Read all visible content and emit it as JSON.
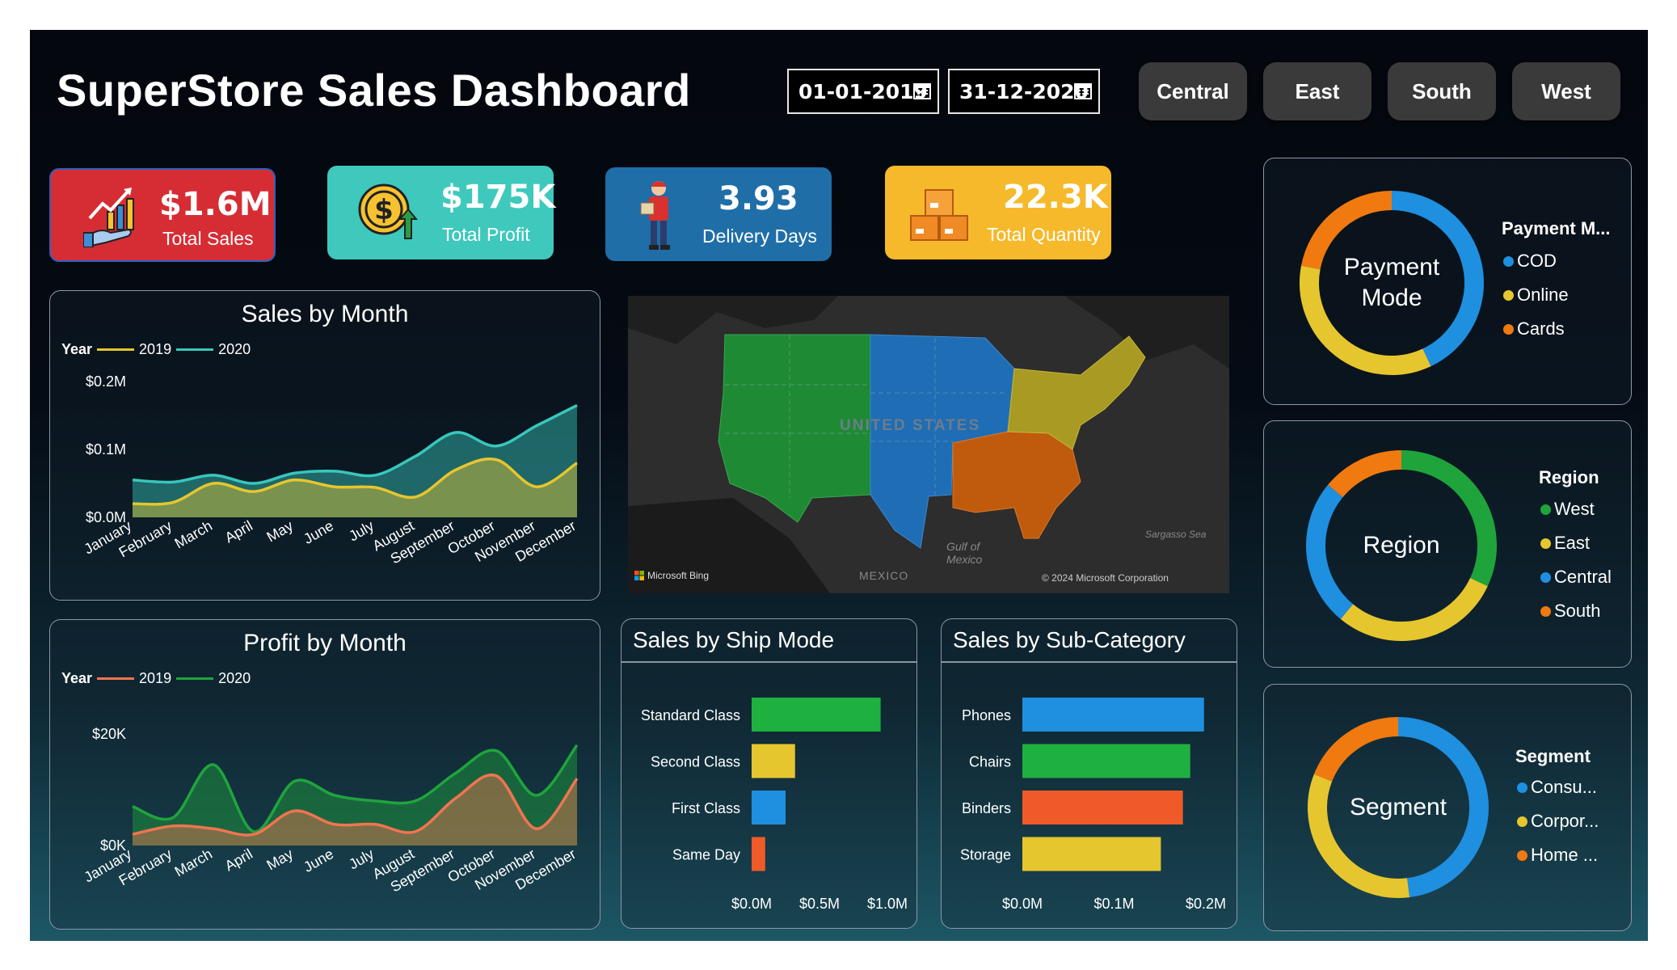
{
  "dashboard": {
    "title": "SuperStore Sales Dashboard",
    "date_start": "01-01-2019",
    "date_end": "31-12-2020",
    "region_buttons": [
      "Central",
      "East",
      "South",
      "West"
    ]
  },
  "kpis": [
    {
      "value": "$1.6M",
      "label": "Total Sales",
      "color": "#d62d35",
      "icon": "sales-hand-chart-icon"
    },
    {
      "value": "$175K",
      "label": "Total Profit",
      "color": "#3ec9bc",
      "icon": "dollar-coin-icon"
    },
    {
      "value": "3.93",
      "label": "Delivery Days",
      "color": "#1f6ea8",
      "icon": "delivery-person-icon"
    },
    {
      "value": "22.3K",
      "label": "Total Quantity",
      "color": "#f6b92b",
      "icon": "boxes-icon"
    }
  ],
  "sales_month": {
    "title": "Sales by Month",
    "legend_title": "Year",
    "chart_data": {
      "type": "area",
      "categories": [
        "January",
        "February",
        "March",
        "April",
        "May",
        "June",
        "July",
        "August",
        "September",
        "October",
        "November",
        "December"
      ],
      "series": [
        {
          "name": "2019",
          "color": "#e6c62e",
          "values": [
            0.02,
            0.022,
            0.05,
            0.038,
            0.055,
            0.045,
            0.044,
            0.03,
            0.07,
            0.085,
            0.045,
            0.08
          ]
        },
        {
          "name": "2020",
          "color": "#38c7bd",
          "values": [
            0.055,
            0.052,
            0.062,
            0.05,
            0.065,
            0.068,
            0.062,
            0.09,
            0.125,
            0.105,
            0.135,
            0.165
          ]
        }
      ],
      "y_ticks": [
        "$0.0M",
        "$0.1M",
        "$0.2M"
      ],
      "ylim": [
        0,
        0.2
      ]
    }
  },
  "profit_month": {
    "title": "Profit by Month",
    "legend_title": "Year",
    "chart_data": {
      "type": "area",
      "categories": [
        "January",
        "February",
        "March",
        "April",
        "May",
        "June",
        "July",
        "August",
        "September",
        "October",
        "November",
        "December"
      ],
      "series": [
        {
          "name": "2019",
          "color": "#f07550",
          "values": [
            2000,
            3500,
            3000,
            2000,
            6200,
            3800,
            3800,
            2500,
            8500,
            12500,
            3000,
            12000
          ]
        },
        {
          "name": "2020",
          "color": "#1fa43c",
          "values": [
            7000,
            5000,
            14500,
            2500,
            11500,
            9000,
            8000,
            8000,
            13000,
            17000,
            9000,
            18000
          ]
        }
      ],
      "y_ticks": [
        "$0K",
        "$20K"
      ],
      "ylim": [
        0,
        20000
      ]
    }
  },
  "map": {
    "country_label": "UNITED STATES",
    "mexico_label": "MEXICO",
    "gulf_label": "Gulf of Mexico",
    "sea_label": "Sargasso Sea",
    "bing_label": "Microsoft Bing",
    "copyright": "© 2024 Microsoft Corporation"
  },
  "ship_mode": {
    "title": "Sales by Ship Mode",
    "chart_data": {
      "type": "bar",
      "categories": [
        "Standard Class",
        "Second Class",
        "First Class",
        "Same Day"
      ],
      "values": [
        0.95,
        0.32,
        0.25,
        0.1
      ],
      "colors": [
        "#1fb140",
        "#e6c62e",
        "#1f8fe0",
        "#f05a28"
      ],
      "x_ticks": [
        "$0.0M",
        "$0.5M",
        "$1.0M"
      ],
      "xlim": [
        0,
        1.0
      ]
    }
  },
  "sub_category": {
    "title": "Sales by Sub-Category",
    "chart_data": {
      "type": "bar",
      "categories": [
        "Phones",
        "Chairs",
        "Binders",
        "Storage"
      ],
      "values": [
        0.198,
        0.183,
        0.175,
        0.151
      ],
      "colors": [
        "#1f8fe0",
        "#1fb140",
        "#f05a28",
        "#e6c62e"
      ],
      "x_ticks": [
        "$0.0M",
        "$0.1M",
        "$0.2M"
      ],
      "xlim": [
        0,
        0.2
      ]
    }
  },
  "payment_donut": {
    "center": [
      "Payment",
      "Mode"
    ],
    "legend_title": "Payment M...",
    "items": [
      {
        "label": "COD",
        "color": "#1f8fe0",
        "share": 0.43
      },
      {
        "label": "Online",
        "color": "#e6c62e",
        "share": 0.35
      },
      {
        "label": "Cards",
        "color": "#f07a10",
        "share": 0.22
      }
    ]
  },
  "region_donut": {
    "center": [
      "Region"
    ],
    "legend_title": "Region",
    "items": [
      {
        "label": "West",
        "color": "#1fa43c",
        "share": 0.32
      },
      {
        "label": "East",
        "color": "#e6c62e",
        "share": 0.29
      },
      {
        "label": "Central",
        "color": "#1f8fe0",
        "share": 0.25
      },
      {
        "label": "South",
        "color": "#f07a10",
        "share": 0.14
      }
    ]
  },
  "segment_donut": {
    "center": [
      "Segment"
    ],
    "legend_title": "Segment",
    "items": [
      {
        "label": "Consu...",
        "color": "#1f8fe0",
        "share": 0.48
      },
      {
        "label": "Corpor...",
        "color": "#e6c62e",
        "share": 0.33
      },
      {
        "label": "Home ...",
        "color": "#f07a10",
        "share": 0.19
      }
    ]
  }
}
